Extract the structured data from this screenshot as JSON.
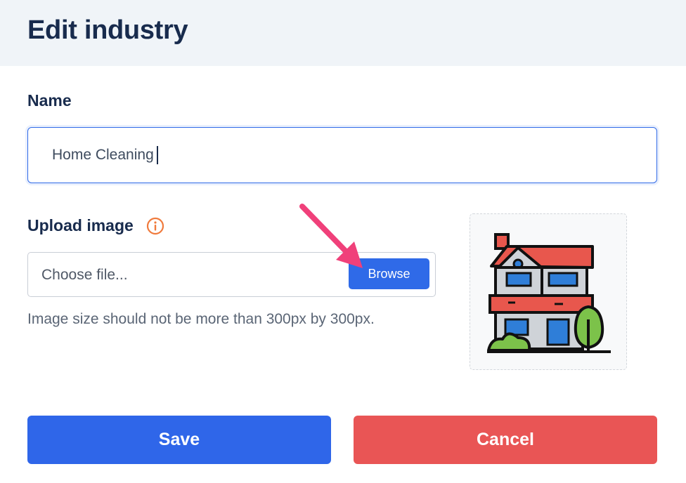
{
  "header": {
    "title": "Edit industry"
  },
  "name_field": {
    "label": "Name",
    "value": "Home Cleaning"
  },
  "upload": {
    "label": "Upload image",
    "placeholder": "Choose file...",
    "browse_label": "Browse",
    "hint": "Image size should not be more than 300px by 300px."
  },
  "actions": {
    "save_label": "Save",
    "cancel_label": "Cancel"
  },
  "colors": {
    "primary": "#2f66e9",
    "danger": "#e95555",
    "info": "#f07a3c",
    "arrow": "#f0407a"
  },
  "icons": {
    "info": "info-circle-icon",
    "arrow": "annotation-arrow",
    "preview": "house-icon"
  }
}
